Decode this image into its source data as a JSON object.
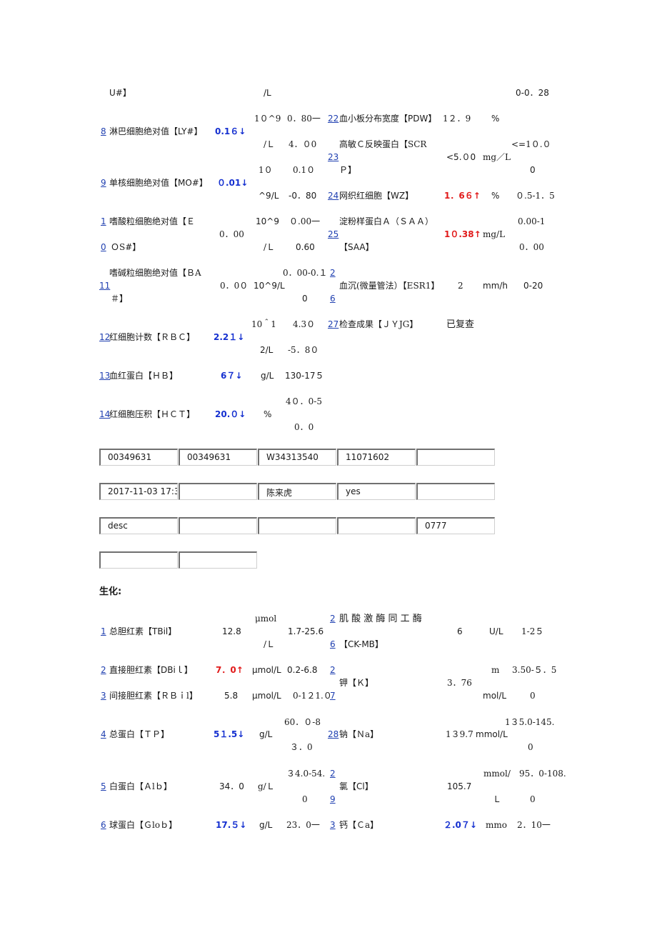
{
  "blood": {
    "row_top": {
      "name": "U#】",
      "unit": "/L",
      "range": "0-0．28"
    },
    "r8": {
      "num": "8",
      "name": "淋巴细胞绝对值【LY#】",
      "val": "0.1６↓",
      "u1": "1０^9",
      "u2": "/Ｌ",
      "rg1": "0．80一",
      "rg2": "4．０0"
    },
    "r22": {
      "num": "22",
      "name": "血小板分布宽度【PDW】",
      "val": "1２．9",
      "unit": "%"
    },
    "r23": {
      "num": "23",
      "name1": "高敏Ｃ反映蛋白【SCR",
      "name2": "Ｐ】",
      "val": "<5.０0",
      "unit": "mg／L",
      "rg1": "<=1０.０",
      "rg2": "0"
    },
    "r9": {
      "num": "9",
      "name": "单核细胞绝对值【MO#】",
      "val": "０.01↓",
      "u1": "1０",
      "u2": "^9/L",
      "rg1": "0.1０",
      "rg2": "-0．80"
    },
    "r24": {
      "num": "24",
      "name": "网织红细胞【WZ】",
      "val": "1．6６↑",
      "unit": "%",
      "range": "０.5-1．5"
    },
    "r10": {
      "num1": "1",
      "num2": "0",
      "name1": "嗜酸粒细胞绝对值【Ｅ",
      "name2": "ＯS#】",
      "val": "0．00",
      "u1": "10^9",
      "u2": "/Ｌ",
      "rg1": "０.00一",
      "rg2": "0.60"
    },
    "r25": {
      "num": "25",
      "name1": "淀粉样蛋白Ａ（ＳＡＡ）",
      "name2": "【SAA】",
      "val": "1０.38↑",
      "unit": "mg/L",
      "rg1": "0.00-1",
      "rg2": "0．00"
    },
    "r11": {
      "num": "11",
      "name1": "嗜碱粒细胞绝对值【ＢA",
      "name2": "＃】",
      "val": "0．0０",
      "u1": "10^9/L",
      "rg1": "0．00-0.１",
      "rg2": "0"
    },
    "r26": {
      "num1": "2",
      "num2": "6",
      "name": "血沉(微量管法）【ESR1】",
      "val": "2",
      "unit": "mm/h",
      "range": "0-20"
    },
    "r12": {
      "num": "12",
      "name": "红细胞计数【ＲＢＣ】",
      "val": "2.2１↓",
      "u1": "10＾1",
      "u2": "2/L",
      "rg1": "4.3０",
      "rg2": "-5．8０"
    },
    "r27": {
      "num": "27",
      "name": "检查成果【ＪＹJG】",
      "val": "已复查"
    },
    "r13": {
      "num": "13",
      "name": "血红蛋白【ＨＢ】",
      "val": "6７↓",
      "unit": "g/L",
      "range": "130-17５"
    },
    "r14": {
      "num": "14",
      "name": "红细胞压积【ＨＣＴ】",
      "val": "20.０↓",
      "unit": "%",
      "rg1": "4０．0-5",
      "rg2": "0．0"
    }
  },
  "grid": [
    [
      "00349631",
      "00349631",
      "W34313540",
      "11071602",
      ""
    ],
    [
      "2017-11-03 17:3",
      "",
      "陈来虎",
      "yes",
      ""
    ],
    [
      "desc",
      "",
      "",
      "",
      "0777"
    ],
    [
      "",
      ""
    ]
  ],
  "biochem_title": "生化:",
  "bio": {
    "r1": {
      "num": "1",
      "name": "总胆红素【TBil】",
      "val": "12.8",
      "u1": "μmol",
      "u2": "/Ｌ",
      "range": "1.7-25.6"
    },
    "r26": {
      "num1": "2",
      "num2": "6",
      "name1": "肌 酸 激 酶 同 工 酶",
      "name2": "【CK-MB】",
      "val": "6",
      "unit": "U/L",
      "range": "1-2５"
    },
    "r2": {
      "num": "2",
      "name": "直接胆红素【DBiｌ】",
      "val": "7．0↑",
      "unit": "μmol/L",
      "range": "0.2-6.8"
    },
    "r27": {
      "num1": "2",
      "num2": "7",
      "name": "钾【Ｋ】",
      "val": "3．76",
      "u1": "m",
      "u2": "mol/L",
      "rg1": "3.50-５．5",
      "rg2": "0"
    },
    "r3": {
      "num": "3",
      "name": "间接胆红素【ＲＢｉl】",
      "val": "5.8",
      "unit": "μmol/L",
      "range": "0-1２1.０"
    },
    "r4": {
      "num": "4",
      "name": "总蛋白【ＴＰ】",
      "val": "5１.5↓",
      "unit": "g/L",
      "rg1": "60．０-8",
      "rg2": "３．0"
    },
    "r28": {
      "num": "28",
      "name": "钠【Ｎa】",
      "val": "1３9.7",
      "unit": "mmol/L",
      "rg1": "1３5.0-145.",
      "rg2": "0"
    },
    "r5": {
      "num": "5",
      "name": "白蛋白【Ａlｂ】",
      "val": "34．0",
      "unit": "g/Ｌ",
      "rg1": "３4.0-54.",
      "rg2": "0"
    },
    "r29": {
      "num1": "2",
      "num2": "9",
      "name": "氯【Cl】",
      "val": "105.7",
      "u1": "mmol/",
      "u2": "Ｌ",
      "rg1": "95．0-108.",
      "rg2": "0"
    },
    "r6": {
      "num": "6",
      "name": "球蛋白【Ｇloｂ】",
      "val": "17.５↓",
      "unit": "g/L",
      "range": "23．0一"
    },
    "r30": {
      "num": "3",
      "name": "钙【Ｃa】",
      "val": "２.0７↓",
      "unit": "mmo",
      "range": "2．10一"
    }
  }
}
